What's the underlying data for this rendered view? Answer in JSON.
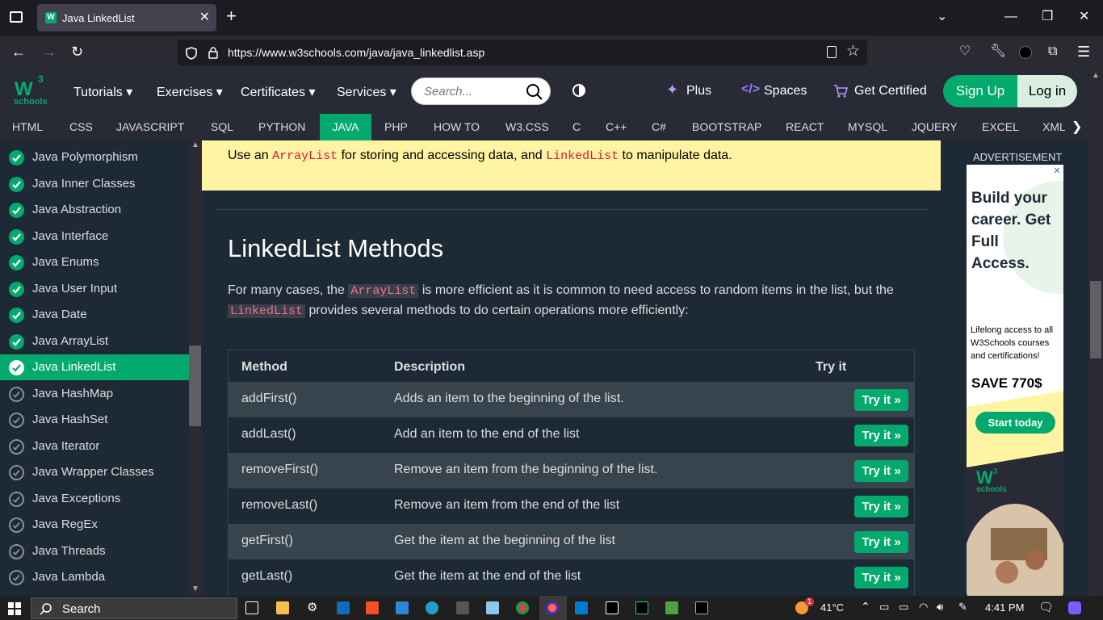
{
  "browser": {
    "tab_title": "Java LinkedList",
    "url": "https://www.w3schools.com/java/java_linkedlist.asp"
  },
  "w3": {
    "logo_text": "schools",
    "logo_sup": "3",
    "menu": [
      "Tutorials ▾",
      "Exercises ▾",
      "Certificates ▾",
      "Services ▾"
    ],
    "search_placeholder": "Search...",
    "plus": "Plus",
    "spaces": "Spaces",
    "certified": "Get Certified",
    "signup": "Sign Up",
    "login": "Log in"
  },
  "topics": [
    "HTML",
    "CSS",
    "JAVASCRIPT",
    "SQL",
    "PYTHON",
    "JAVA",
    "PHP",
    "HOW TO",
    "W3.CSS",
    "C",
    "C++",
    "C#",
    "BOOTSTRAP",
    "REACT",
    "MYSQL",
    "JQUERY",
    "EXCEL",
    "XML"
  ],
  "active_topic": "JAVA",
  "sidebar": [
    {
      "label": "Java Polymorphism",
      "done": true
    },
    {
      "label": "Java Inner Classes",
      "done": true
    },
    {
      "label": "Java Abstraction",
      "done": true
    },
    {
      "label": "Java Interface",
      "done": true
    },
    {
      "label": "Java Enums",
      "done": true
    },
    {
      "label": "Java User Input",
      "done": true
    },
    {
      "label": "Java Date",
      "done": true
    },
    {
      "label": "Java ArrayList",
      "done": true
    },
    {
      "label": "Java LinkedList",
      "done": true,
      "active": true
    },
    {
      "label": "Java HashMap",
      "done": false
    },
    {
      "label": "Java HashSet",
      "done": false
    },
    {
      "label": "Java Iterator",
      "done": false
    },
    {
      "label": "Java Wrapper Classes",
      "done": false
    },
    {
      "label": "Java Exceptions",
      "done": false
    },
    {
      "label": "Java RegEx",
      "done": false
    },
    {
      "label": "Java Threads",
      "done": false
    },
    {
      "label": "Java Lambda",
      "done": false
    }
  ],
  "note": {
    "pre": "Use an ",
    "code1": "ArrayList",
    "mid": " for storing and accessing data, and ",
    "code2": "LinkedList",
    "post": " to manipulate data."
  },
  "heading": "LinkedList Methods",
  "para": {
    "p1": "For many cases, the ",
    "c1": "ArrayList",
    "p2": " is more efficient as it is common to need access to random items in the list, but the ",
    "c2": "LinkedList",
    "p3": " provides several methods to do certain operations more efficiently:"
  },
  "table": {
    "headers": [
      "Method",
      "Description",
      "Try it"
    ],
    "try_label": "Try it »",
    "rows": [
      {
        "method": "addFirst()",
        "desc": "Adds an item to the beginning of the list."
      },
      {
        "method": "addLast()",
        "desc": "Add an item to the end of the list"
      },
      {
        "method": "removeFirst()",
        "desc": "Remove an item from the beginning of the list."
      },
      {
        "method": "removeLast()",
        "desc": "Remove an item from the end of the list"
      },
      {
        "method": "getFirst()",
        "desc": "Get the item at the beginning of the list"
      },
      {
        "method": "getLast()",
        "desc": "Get the item at the end of the list"
      }
    ]
  },
  "ad": {
    "label": "ADVERTISEMENT",
    "headline": "Build your career. Get Full Access.",
    "sub": "Lifelong access to all W3Schools courses and certifications!",
    "save": "SAVE 770$",
    "button": "Start today",
    "logo_text": "schools",
    "logo_sup": "3"
  },
  "taskbar": {
    "search": "Search",
    "weather": "41°C",
    "time": "4:41 PM",
    "notif_badge": "1"
  }
}
